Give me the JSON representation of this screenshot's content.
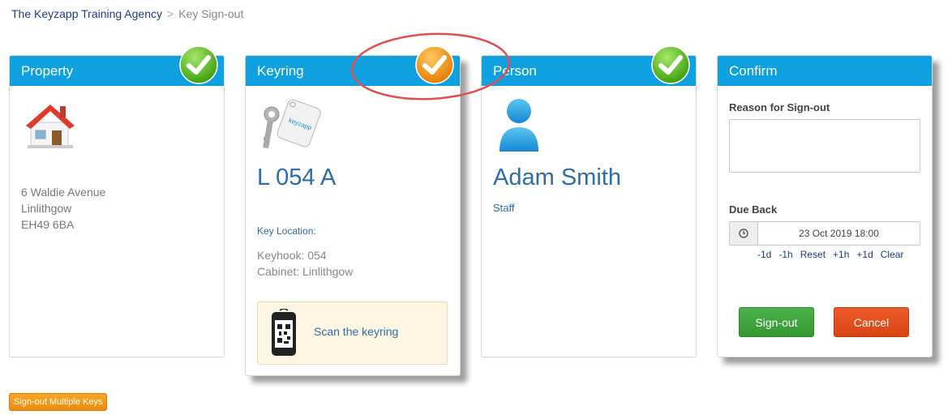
{
  "breadcrumb": {
    "home": "The Keyzapp Training Agency",
    "separator": ">",
    "current": "Key Sign-out"
  },
  "property": {
    "header": "Property",
    "address": [
      "6 Waldie Avenue",
      "Linlithgow",
      "EH49 6BA"
    ],
    "status": "complete"
  },
  "keyring": {
    "header": "Keyring",
    "key_label": "keyzapp",
    "code": "L 054 A",
    "location_label": "Key Location:",
    "location_lines": [
      "Keyhook: 054",
      "Cabinet: Linlithgow"
    ],
    "scan_text": "Scan the keyring",
    "status": "warning"
  },
  "person": {
    "header": "Person",
    "name": "Adam Smith",
    "role": "Staff",
    "status": "complete"
  },
  "confirm": {
    "header": "Confirm",
    "reason_label": "Reason for Sign-out",
    "reason_value": "",
    "due_label": "Due Back",
    "due_value": "23 Oct 2019  18:00",
    "adjust": [
      "-1d",
      "-1h",
      "Reset",
      "+1h",
      "+1d",
      "Clear"
    ],
    "signout_label": "Sign-out",
    "cancel_label": "Cancel"
  },
  "footer": {
    "multi_label": "Sign-out Multiple Keys"
  },
  "colors": {
    "header_blue": "#0fa0e0",
    "check_green": "#5cc21f",
    "check_orange": "#f39a12",
    "annotation_red": "#e05050",
    "link_blue": "#2f6ea5"
  }
}
